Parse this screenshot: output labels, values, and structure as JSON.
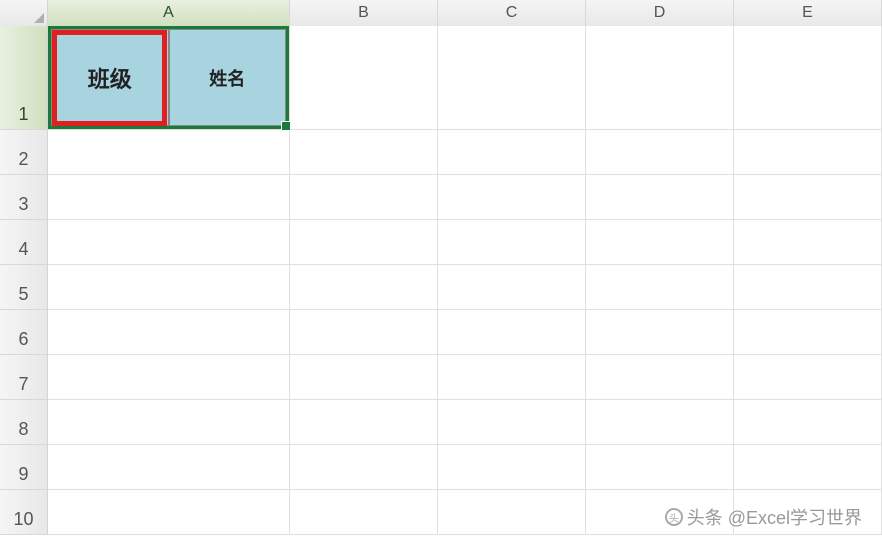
{
  "columns": [
    "A",
    "B",
    "C",
    "D",
    "E"
  ],
  "rows": [
    1,
    2,
    3,
    4,
    5,
    6,
    7,
    8,
    9,
    10
  ],
  "active_column": "A",
  "active_row": 1,
  "cells": {
    "A1": {
      "left_text": "班级",
      "right_text": "姓名",
      "fill_color": "#a8d4e0",
      "selected": true,
      "red_highlight_half": "left"
    }
  },
  "selection_border_color": "#1a7a3a",
  "highlight_border_color": "#e02020",
  "watermark": {
    "text": "头条 @Excel学习世界"
  }
}
